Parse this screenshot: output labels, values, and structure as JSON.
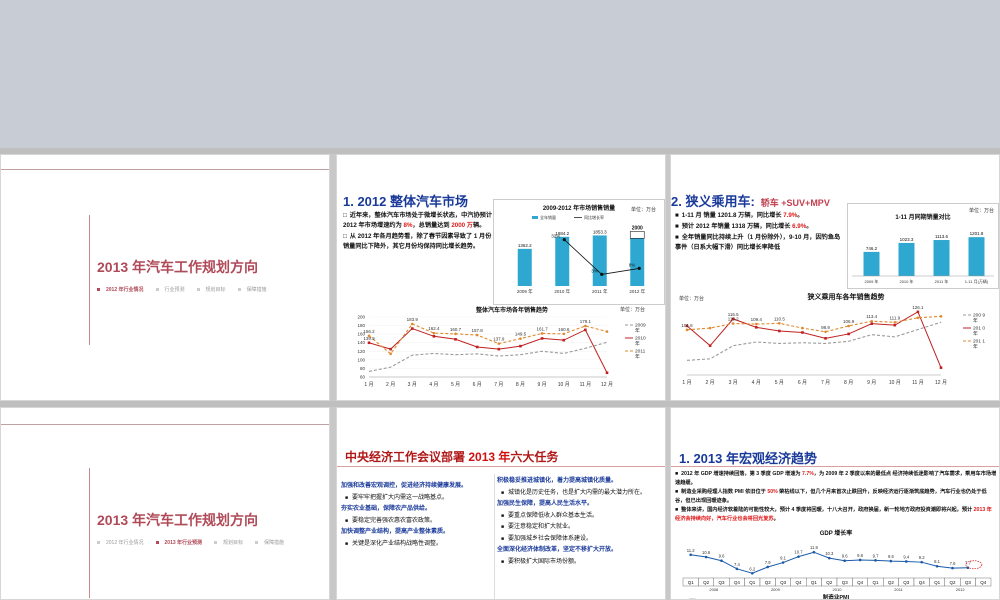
{
  "slide1": {
    "title": "2013 年汽车工作规划方向",
    "nav": [
      "2012 年行业情况",
      "行业预测",
      "规划目标",
      "保障措施"
    ],
    "active_nav": 0
  },
  "slide2": {
    "title": "1. 2012 整体汽车市场",
    "bullets": [
      {
        "pre": "近年来，整体汽车市场处于微增长状态，中汽协预计 2012 年市场增速约为 ",
        "hl": "8%",
        "post": "，总销量达到 ",
        "hl2": "2000 万",
        "post2": "辆。"
      },
      {
        "pre": "从 2012 年各月趋势看，除了春节因素导致了 1 月份销量同比下降外，其它月份均保持同比增长趋势。",
        "hl": "",
        "post": "",
        "hl2": "",
        "post2": ""
      }
    ],
    "bar_chart": {
      "title": "2009-2012 年市场销售销量",
      "unit": "单位：万台",
      "legend": [
        "全年销量",
        "同比增长率"
      ],
      "categories": [
        "2009 年",
        "2010 年",
        "2011 年",
        "2012 年"
      ],
      "values": [
        1362.2,
        1804.2,
        1853.5,
        1749.4
      ],
      "value_labels": [
        "1362.2",
        "1884.2",
        "1853.3",
        "1749.4"
      ],
      "target_label": "2000",
      "growth_labels": [
        "",
        "32%",
        "3%",
        "8%"
      ],
      "growth": [
        null,
        32,
        3,
        8
      ]
    },
    "line_chart": {
      "title": "整体汽车市场各年销售趋势",
      "unit": "单位：万台",
      "yticks": [
        "200",
        "180",
        "160",
        "140",
        "120",
        "100",
        "80",
        "60"
      ],
      "months": [
        "1 月",
        "2 月",
        "3 月",
        "4 月",
        "5 月",
        "6 月",
        "7 月",
        "8 月",
        "9 月",
        "10 月",
        "11 月",
        "12 月"
      ],
      "legend": [
        "2009 年",
        "2010 年",
        "2011 年"
      ],
      "series": [
        {
          "name": "2009 年",
          "color": "#9a9a9a",
          "values": [
            73,
            83,
            111,
            115,
            112,
            114,
            109,
            112,
            120,
            115,
            127,
            141
          ]
        },
        {
          "name": "2010 年",
          "color": "#c02020",
          "values": [
            139.9,
            125,
            173,
            155,
            148,
            130,
            125,
            132,
            150,
            146,
            170,
            70
          ]
        },
        {
          "name": "2011 年",
          "color": "#e08a30",
          "values": [
            156.2,
            114,
            183.9,
            162.4,
            160.7,
            157.8,
            137.9,
            149.5,
            161.7,
            160.6,
            179.1,
            166
          ]
        }
      ],
      "data_labels": [
        "139.9",
        "156.2",
        "183.9",
        "162.4",
        "160.7",
        "157.8",
        "137.9",
        "149.5",
        "161.7",
        "160.6",
        "179.1"
      ]
    }
  },
  "slide3": {
    "title": "2. 狭义乘用车:",
    "subtitle": "轿车 +SUV+MPV",
    "bullets": [
      {
        "pre": "1-11 月        销量 1201.8 万辆，同比增长 ",
        "hl": "7.9%",
        "post": "。"
      },
      {
        "pre": "预计 2012 年销量    1318  万辆，同比增长 ",
        "hl": "6.9%",
        "post": "。"
      },
      {
        "pre": "全年销量同比持续上升（1 月份除外），9-10 月，因钓鱼岛事件（日系大幅下滑）同比增长率降低",
        "hl": "",
        "post": ""
      }
    ],
    "bar_chart": {
      "title": "1-11 月同期销量对比",
      "unit": "单位：万台",
      "categories": [
        "2009 年",
        "2010 年",
        "2011 年",
        "1-11 月(万辆)"
      ],
      "values": [
        746.2,
        1023.3,
        1113.6,
        1201.8
      ],
      "value_labels": [
        "746.2",
        "1023.3",
        "1113.6",
        "1201.8"
      ]
    },
    "line_chart": {
      "title": "狭义乘用车各年销售趋势",
      "unit": "单位：万台",
      "months": [
        "1 月",
        "2 月",
        "3 月",
        "4 月",
        "5 月",
        "6 月",
        "7 月",
        "8 月",
        "9 月",
        "10 月",
        "11 月",
        "12 月"
      ],
      "legend": [
        "200 9 年",
        "201 0 年",
        "201 1 年"
      ],
      "series": [
        {
          "name": "200 9 年",
          "color": "#9a9a9a",
          "values": [
            60,
            62,
            80,
            85,
            83,
            84,
            83,
            86,
            95,
            92,
            102,
            112
          ]
        },
        {
          "name": "201 0 年",
          "color": "#c02020",
          "values": [
            107,
            80,
            116.5,
            105,
            100,
            98,
            90,
            96,
            110,
            108,
            126.1,
            50
          ]
        },
        {
          "name": "201 1 年",
          "color": "#e08a30",
          "values": [
            101.6,
            104,
            110.2,
            109.4,
            110.5,
            104,
            98.9,
            106.9,
            113.4,
            111.9,
            118,
            120
          ]
        }
      ],
      "data_labels": [
        "101.6",
        "116.5",
        "110.2",
        "109.4",
        "110.5",
        "98.9",
        "106.9",
        "113.4",
        "111.9",
        "126.1"
      ]
    }
  },
  "slide4": {
    "title": "2013 年汽车工作规划方向",
    "nav": [
      "2012 年行业情况",
      "2013 年行业预测",
      "规划目标",
      "保障措施"
    ],
    "active_nav": 1
  },
  "slide5": {
    "title_pre": "中央经济工作会议部署 ",
    "title_hl": "2013 年",
    "title_post": "六大任务",
    "left": [
      {
        "t": "加强和改善宏观调控，促进经济持续健康发展。",
        "blue": true
      },
      {
        "t": "要牢牢把握扩大内需这一战略基点。",
        "blue": false
      },
      {
        "t": "夯实农业基础，保障农产品供给。",
        "blue": true
      },
      {
        "t": "要稳定完善强农惠农富农政策。",
        "blue": false
      },
      {
        "t": "加快调整产业结构，提高产业整体素质。",
        "blue": true
      },
      {
        "t": "关键是深化产业结构战略性调整。",
        "blue": false
      }
    ],
    "right": [
      {
        "t": "积极稳妥推进城镇化，着力提高城镇化质量。",
        "blue": true
      },
      {
        "t": "城镇化是历史任务，也是扩大内需的最大潜力所在。",
        "blue": false
      },
      {
        "t": "加强民生保障，提高人民生活水平。",
        "blue": true
      },
      {
        "t": "要重点保障低收入群众基本生活。",
        "blue": false
      },
      {
        "t": "要注意稳定和扩大就业。",
        "blue": false
      },
      {
        "t": "要加强城乡社会保障体系建设。",
        "blue": false
      },
      {
        "t": "全面深化经济体制改革，坚定不移扩大开放。",
        "blue": true
      },
      {
        "t": "要积极扩大国际市场份额。",
        "blue": false
      }
    ]
  },
  "slide6": {
    "title": "1. 2013 年宏观经济趋势",
    "bullets": [
      {
        "pre": "2012 年 GDP 增速持续回落，第 3 季度 GDP 增速为 ",
        "hl": "7.7%",
        "post": "，为 2009 年 2 季度以来的最低点    经济持续低迷影响了汽车需求，乘用车市场增速趋缓。"
      },
      {
        "pre": "制造业采购经理人指数 PMI 依旧位于 ",
        "hl": "50%",
        "post": " 荣枯线以下，但几个月来首次止跌回升，反映经济运行逐渐筑底趋势，汽车行业也仍处于低谷，但已出现回暖迹象。"
      },
      {
        "pre": "整体来讲，国内经济软着陆的可能性较大，预计 4 季度将回暖，十八大召开，政府换届，新一轮地方政府投资潮即将兴起，预计 ",
        "hl": "2013 年经济会持续向好，汽车行业也会将回光复苏",
        "post": "。"
      }
    ],
    "gdp_chart": {
      "title": "GDP 增长率",
      "values": [
        11.2,
        10.6,
        9.6,
        7.4,
        6.2,
        7.9,
        9.1,
        10.7,
        11.9,
        10.3,
        9.6,
        9.8,
        9.7,
        9.5,
        9.4,
        9.2,
        8.1,
        7.6,
        7.7
      ],
      "value_labels": [
        "11.2",
        "10.6",
        "9.6",
        "7.4",
        "6.2",
        "7.9",
        "9.1",
        "10.7",
        "11.9",
        "10.3",
        "9.6",
        "9.8",
        "9.7",
        "9.5",
        "9.4",
        "9.2",
        "8.1",
        "7.6",
        "7.7"
      ],
      "quarters": [
        "Q1",
        "Q2",
        "Q3",
        "Q4",
        "Q1",
        "Q2",
        "Q3",
        "Q4",
        "Q1",
        "Q2",
        "Q3",
        "Q4",
        "Q1",
        "Q2",
        "Q3",
        "Q4",
        "Q1",
        "Q2",
        "Q3",
        "Q4"
      ],
      "years": [
        "2008",
        "2009",
        "2010",
        "2011",
        "2012"
      ],
      "pmi_title": "制造业PMI",
      "pmi_label": "60%"
    }
  }
}
